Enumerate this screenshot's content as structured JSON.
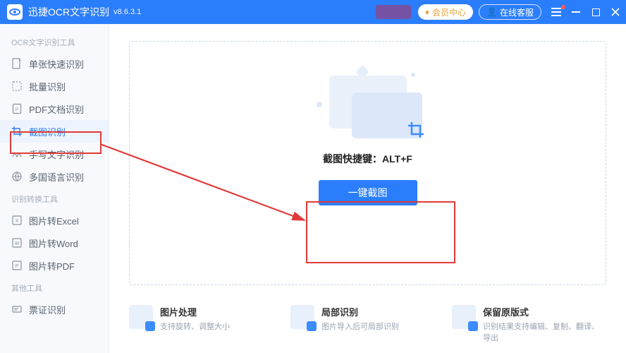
{
  "titlebar": {
    "appName": "迅捷OCR文字识别",
    "version": "v8.6.3.1",
    "memberCenter": "会员中心",
    "customerService": "在线客服"
  },
  "sidebar": {
    "group1": {
      "title": "OCR文字识别工具"
    },
    "items1": [
      {
        "label": "单张快速识别"
      },
      {
        "label": "批量识别"
      },
      {
        "label": "PDF文档识别"
      },
      {
        "label": "截图识别"
      },
      {
        "label": "手写文字识别"
      },
      {
        "label": "多国语言识别"
      }
    ],
    "group2": {
      "title": "识别转换工具"
    },
    "items2": [
      {
        "label": "图片转Excel"
      },
      {
        "label": "图片转Word"
      },
      {
        "label": "图片转PDF"
      }
    ],
    "group3": {
      "title": "其他工具"
    },
    "items3": [
      {
        "label": "票证识别"
      }
    ]
  },
  "dropzone": {
    "shortcut": "截图快捷键：ALT+F",
    "button": "一键截图"
  },
  "features": [
    {
      "title": "图片处理",
      "desc": "支持旋转、调整大小"
    },
    {
      "title": "局部识别",
      "desc": "图片导入后可局部识别"
    },
    {
      "title": "保留原版式",
      "desc": "识别结果支持编辑、复制、翻译、导出"
    }
  ]
}
